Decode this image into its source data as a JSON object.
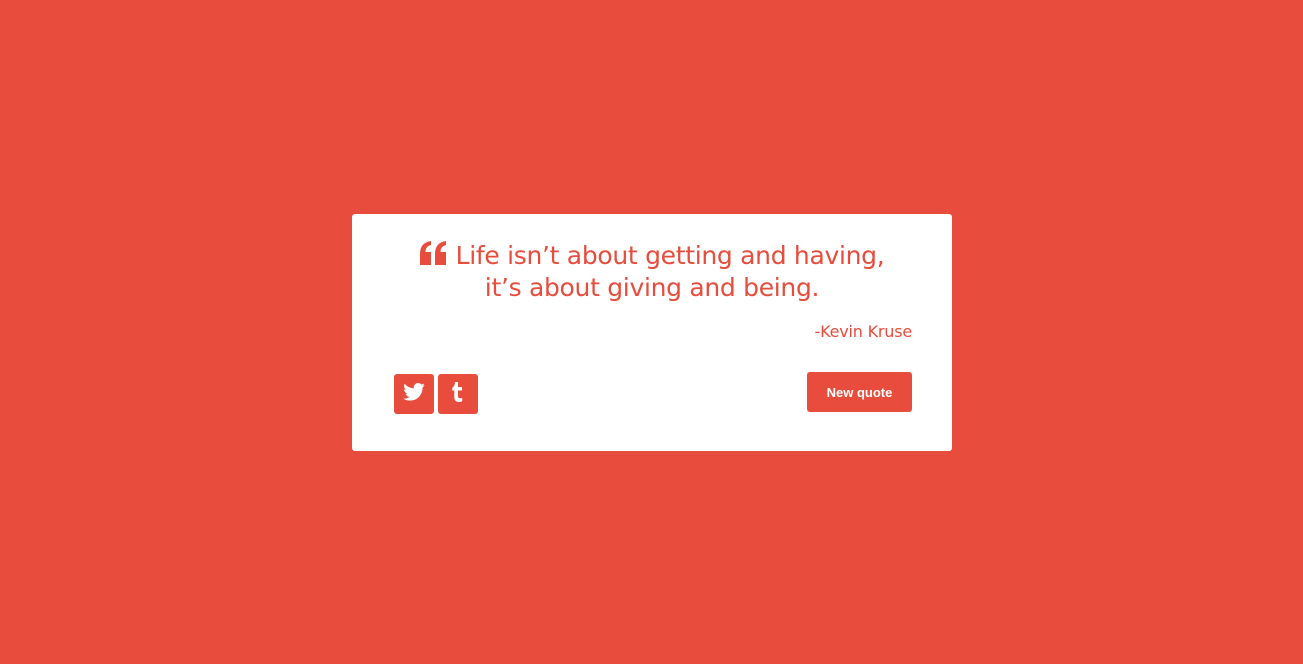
{
  "theme": {
    "accent_color": "#e74c3c",
    "card_color": "#ffffff"
  },
  "quote": {
    "line1": "Life isn’t about getting and having,",
    "line2": "it’s about giving and being.",
    "author": "-Kevin Kruse",
    "icon": "quote-left-icon"
  },
  "share": {
    "twitter_icon": "twitter-icon",
    "tumblr_icon": "tumblr-icon"
  },
  "actions": {
    "new_quote_label": "New quote"
  }
}
